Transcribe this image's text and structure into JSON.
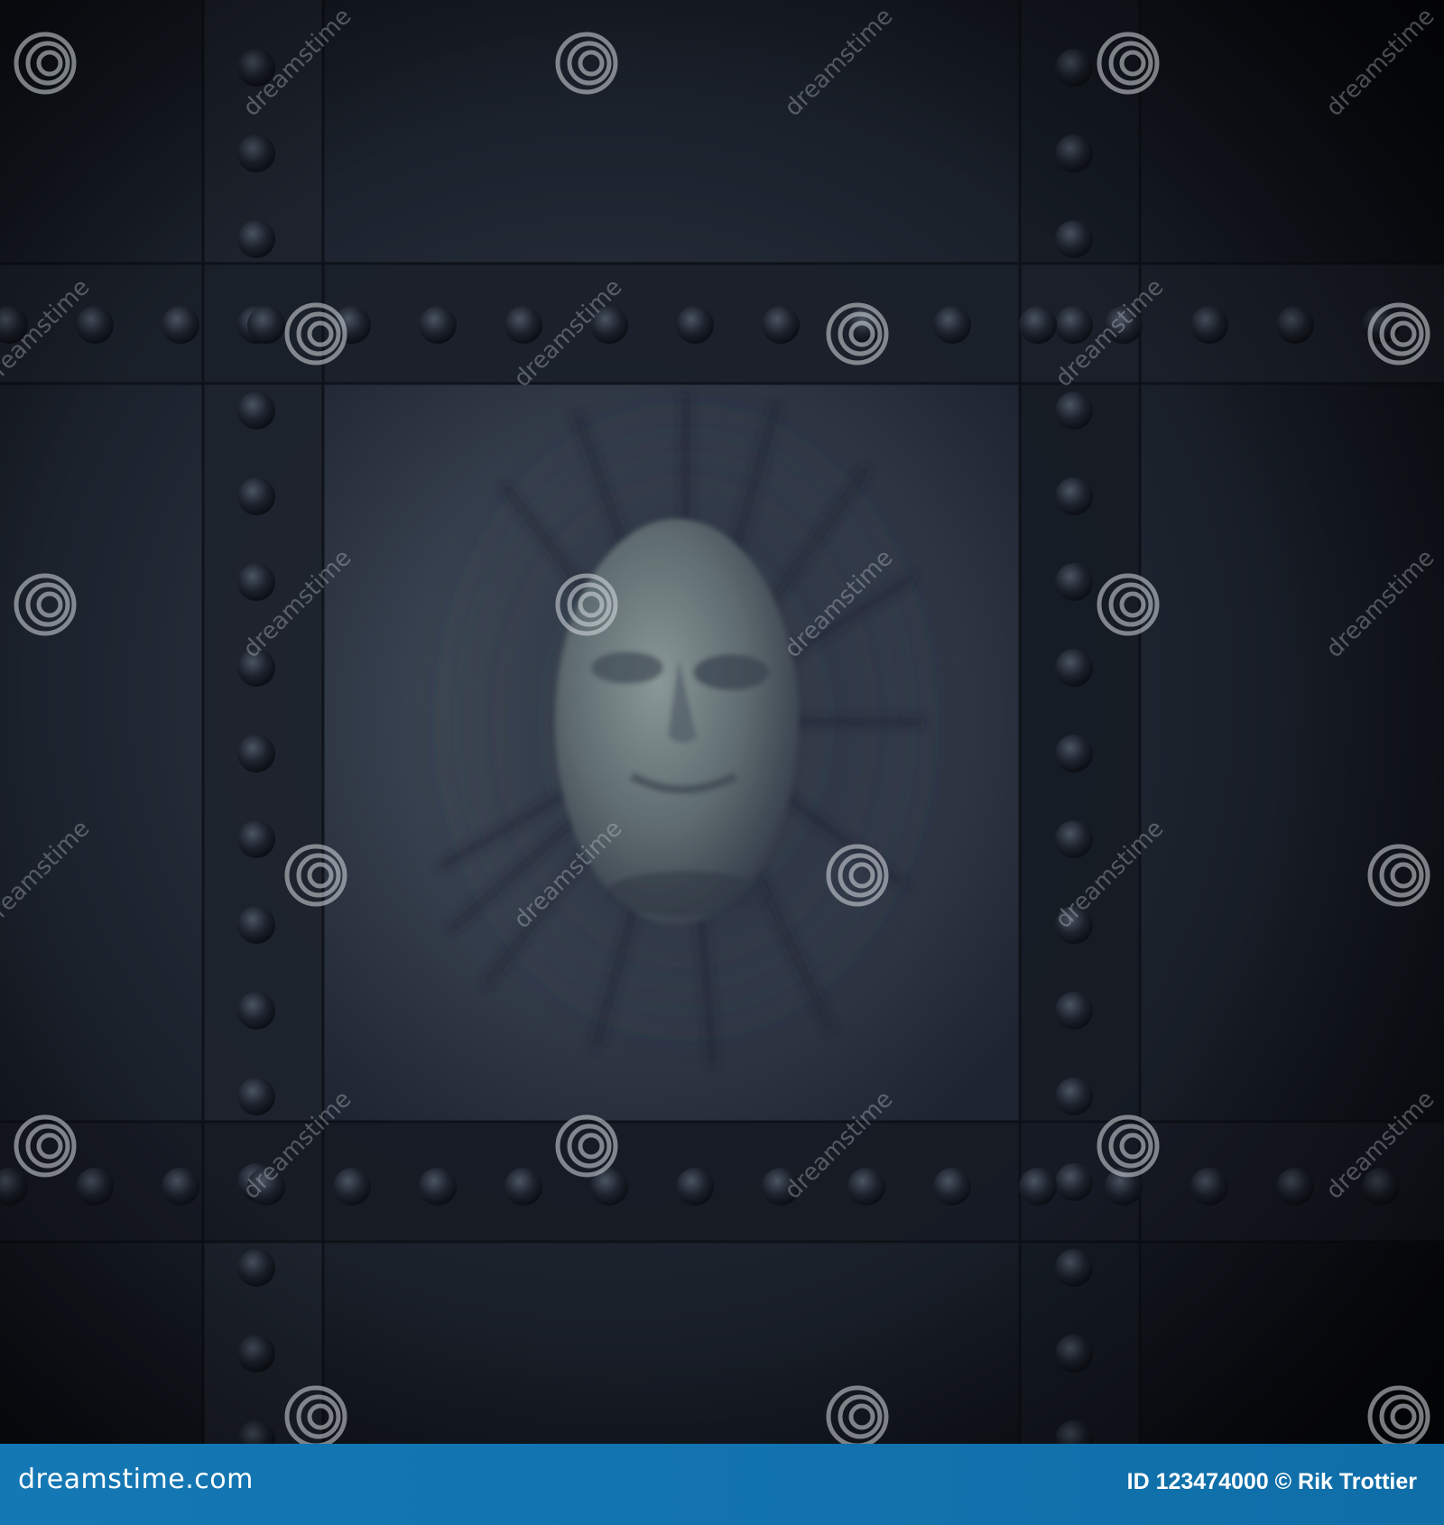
{
  "image": {
    "description_kind": "photograph",
    "watermark_text": "dreamstime",
    "watermark_icon": "spiral-logo-icon"
  },
  "footer": {
    "brand": "dreamstime.com",
    "credit": "ID 123474000 © Rik Trottier",
    "background_color": "#1478b4",
    "text_color": "#ffffff"
  },
  "colors": {
    "panel_dark": "#141923",
    "panel_mid": "#1e2430",
    "face_light": "#6f7f80",
    "beam": "#1a1f29"
  }
}
